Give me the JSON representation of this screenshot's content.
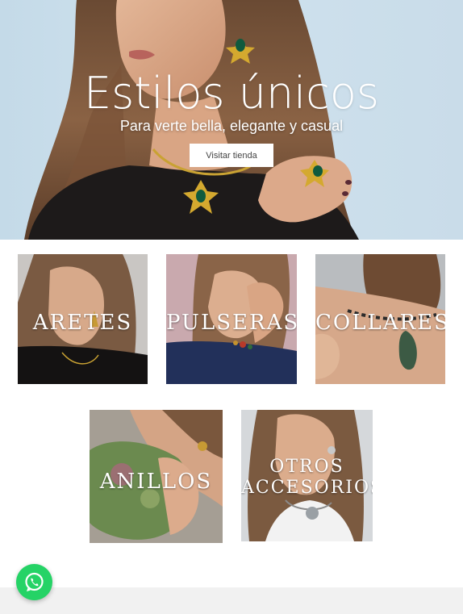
{
  "hero": {
    "title": "Estilos únicos",
    "subtitle": "Para verte bella, elegante y casual",
    "button_label": "Visitar tienda"
  },
  "categories": [
    {
      "label": "ARETES"
    },
    {
      "label": "PULSERAS"
    },
    {
      "label": "COLLARES"
    },
    {
      "label": "ANILLOS"
    },
    {
      "label": "OTROS ACCESORIOS"
    }
  ],
  "whatsapp": {
    "icon": "whatsapp-icon"
  },
  "colors": {
    "whatsapp_green": "#25d366",
    "hero_background": "#c9dce9",
    "footer_strip": "#f1f1f1"
  }
}
